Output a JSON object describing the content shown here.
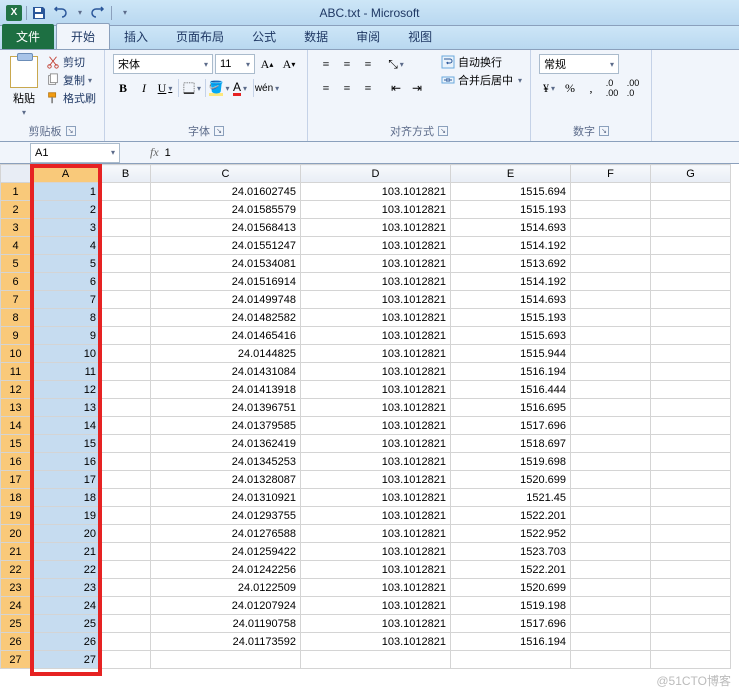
{
  "title": "ABC.txt - Microsoft",
  "qat": {
    "save": "save-icon",
    "undo": "undo-icon",
    "redo": "redo-icon"
  },
  "tabs": {
    "file": "文件",
    "items": [
      "开始",
      "插入",
      "页面布局",
      "公式",
      "数据",
      "审阅",
      "视图"
    ],
    "active": 0
  },
  "ribbon": {
    "clipboard": {
      "title": "剪贴板",
      "paste": "粘贴",
      "cut": "剪切",
      "copy": "复制",
      "format_painter": "格式刷"
    },
    "font": {
      "title": "字体",
      "name": "宋体",
      "size": "11"
    },
    "alignment": {
      "title": "对齐方式",
      "wrap": "自动换行",
      "merge": "合并后居中"
    },
    "number": {
      "title": "数字",
      "format": "常规"
    }
  },
  "namebox": "A1",
  "formula": "1",
  "columns": [
    "A",
    "B",
    "C",
    "D",
    "E",
    "F",
    "G"
  ],
  "rows": [
    {
      "n": 1,
      "A": "1",
      "C": "24.01602745",
      "D": "103.1012821",
      "E": "1515.694"
    },
    {
      "n": 2,
      "A": "2",
      "C": "24.01585579",
      "D": "103.1012821",
      "E": "1515.193"
    },
    {
      "n": 3,
      "A": "3",
      "C": "24.01568413",
      "D": "103.1012821",
      "E": "1514.693"
    },
    {
      "n": 4,
      "A": "4",
      "C": "24.01551247",
      "D": "103.1012821",
      "E": "1514.192"
    },
    {
      "n": 5,
      "A": "5",
      "C": "24.01534081",
      "D": "103.1012821",
      "E": "1513.692"
    },
    {
      "n": 6,
      "A": "6",
      "C": "24.01516914",
      "D": "103.1012821",
      "E": "1514.192"
    },
    {
      "n": 7,
      "A": "7",
      "C": "24.01499748",
      "D": "103.1012821",
      "E": "1514.693"
    },
    {
      "n": 8,
      "A": "8",
      "C": "24.01482582",
      "D": "103.1012821",
      "E": "1515.193"
    },
    {
      "n": 9,
      "A": "9",
      "C": "24.01465416",
      "D": "103.1012821",
      "E": "1515.693"
    },
    {
      "n": 10,
      "A": "10",
      "C": "24.0144825",
      "D": "103.1012821",
      "E": "1515.944"
    },
    {
      "n": 11,
      "A": "11",
      "C": "24.01431084",
      "D": "103.1012821",
      "E": "1516.194"
    },
    {
      "n": 12,
      "A": "12",
      "C": "24.01413918",
      "D": "103.1012821",
      "E": "1516.444"
    },
    {
      "n": 13,
      "A": "13",
      "C": "24.01396751",
      "D": "103.1012821",
      "E": "1516.695"
    },
    {
      "n": 14,
      "A": "14",
      "C": "24.01379585",
      "D": "103.1012821",
      "E": "1517.696"
    },
    {
      "n": 15,
      "A": "15",
      "C": "24.01362419",
      "D": "103.1012821",
      "E": "1518.697"
    },
    {
      "n": 16,
      "A": "16",
      "C": "24.01345253",
      "D": "103.1012821",
      "E": "1519.698"
    },
    {
      "n": 17,
      "A": "17",
      "C": "24.01328087",
      "D": "103.1012821",
      "E": "1520.699"
    },
    {
      "n": 18,
      "A": "18",
      "C": "24.01310921",
      "D": "103.1012821",
      "E": "1521.45"
    },
    {
      "n": 19,
      "A": "19",
      "C": "24.01293755",
      "D": "103.1012821",
      "E": "1522.201"
    },
    {
      "n": 20,
      "A": "20",
      "C": "24.01276588",
      "D": "103.1012821",
      "E": "1522.952"
    },
    {
      "n": 21,
      "A": "21",
      "C": "24.01259422",
      "D": "103.1012821",
      "E": "1523.703"
    },
    {
      "n": 22,
      "A": "22",
      "C": "24.01242256",
      "D": "103.1012821",
      "E": "1522.201"
    },
    {
      "n": 23,
      "A": "23",
      "C": "24.0122509",
      "D": "103.1012821",
      "E": "1520.699"
    },
    {
      "n": 24,
      "A": "24",
      "C": "24.01207924",
      "D": "103.1012821",
      "E": "1519.198"
    },
    {
      "n": 25,
      "A": "25",
      "C": "24.01190758",
      "D": "103.1012821",
      "E": "1517.696"
    },
    {
      "n": 26,
      "A": "26",
      "C": "24.01173592",
      "D": "103.1012821",
      "E": "1516.194"
    },
    {
      "n": 27,
      "A": "27",
      "C": "",
      "D": "",
      "E": ""
    }
  ],
  "watermark": "@51CTO博客"
}
